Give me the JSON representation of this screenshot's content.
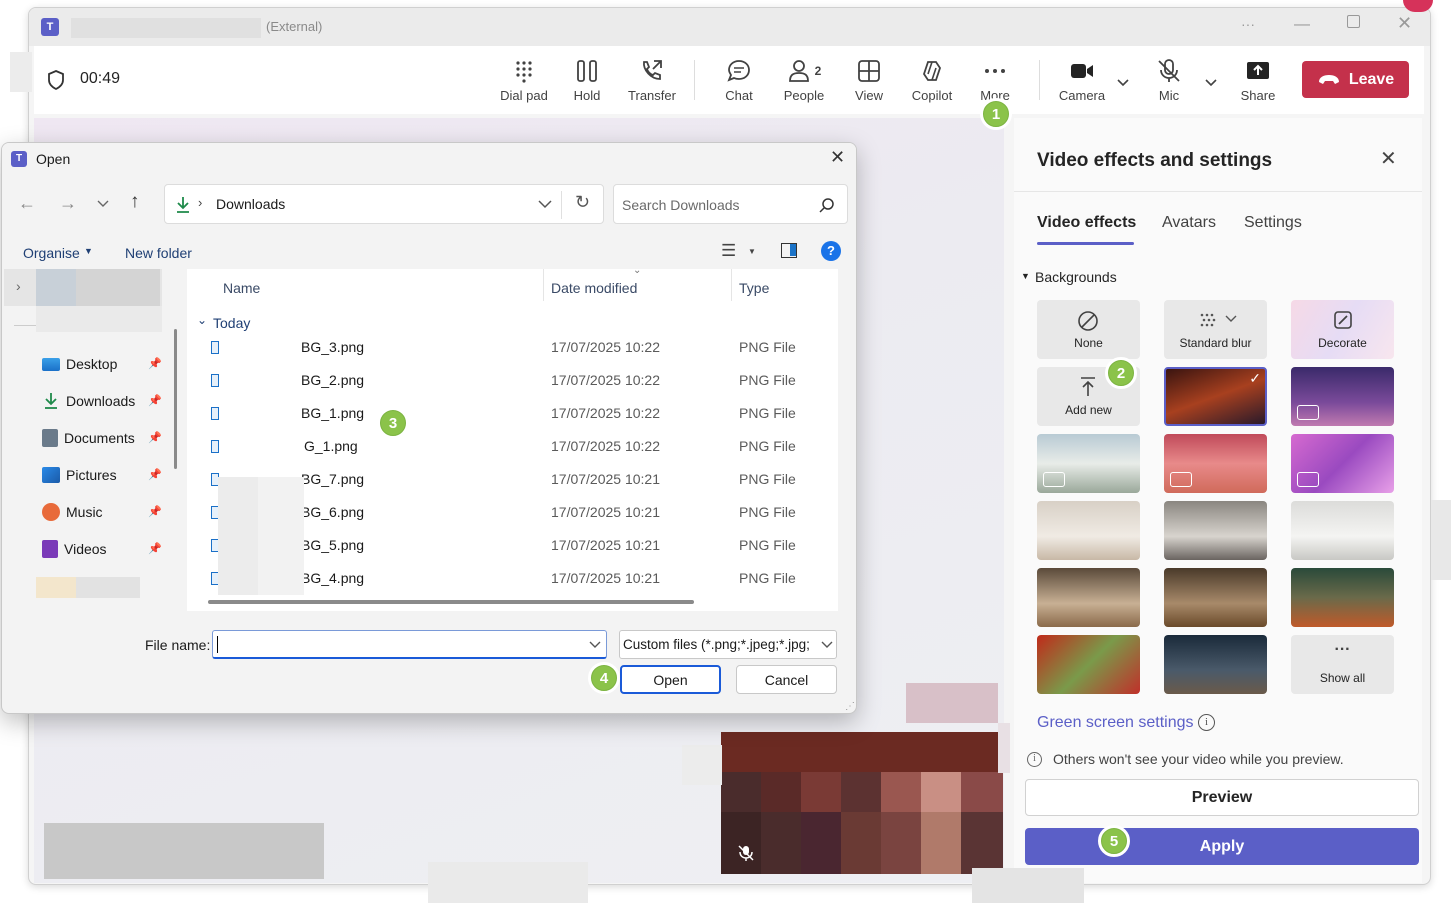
{
  "teams": {
    "title_suffix": "(External)",
    "timer": "00:49",
    "toolbar": {
      "dial_pad": "Dial pad",
      "hold": "Hold",
      "transfer": "Transfer",
      "chat": "Chat",
      "people": "People",
      "people_count": "2",
      "view": "View",
      "copilot": "Copilot",
      "more": "More",
      "camera": "Camera",
      "mic": "Mic",
      "share": "Share",
      "leave": "Leave"
    }
  },
  "panel": {
    "title": "Video effects and settings",
    "tabs": [
      "Video effects",
      "Avatars",
      "Settings"
    ],
    "section": "Backgrounds",
    "tiles": {
      "none": "None",
      "standard_blur": "Standard blur",
      "decorate": "Decorate",
      "add_new": "Add new",
      "show_all": "Show all"
    },
    "green_screen": "Green screen settings",
    "preview_note": "Others won't see your video while you preview.",
    "preview_button": "Preview",
    "apply_button": "Apply"
  },
  "dialog": {
    "title": "Open",
    "path": "Downloads",
    "search_placeholder": "Search Downloads",
    "organise": "Organise",
    "new_folder": "New folder",
    "columns": [
      "Name",
      "Date modified",
      "Type"
    ],
    "group": "Today",
    "files": [
      {
        "name": "BG_3.png",
        "date": "17/07/2025 10:22",
        "type": "PNG File"
      },
      {
        "name": "BG_2.png",
        "date": "17/07/2025 10:22",
        "type": "PNG File"
      },
      {
        "name": "BG_1.png",
        "date": "17/07/2025 10:22",
        "type": "PNG File"
      },
      {
        "name": "G_1.png",
        "date": "17/07/2025 10:22",
        "type": "PNG File"
      },
      {
        "name": "BG_7.png",
        "date": "17/07/2025 10:21",
        "type": "PNG File"
      },
      {
        "name": "BG_6.png",
        "date": "17/07/2025 10:21",
        "type": "PNG File"
      },
      {
        "name": "BG_5.png",
        "date": "17/07/2025 10:21",
        "type": "PNG File"
      },
      {
        "name": "BG_4.png",
        "date": "17/07/2025 10:21",
        "type": "PNG File"
      }
    ],
    "nav": [
      "Desktop",
      "Downloads",
      "Documents",
      "Pictures",
      "Music",
      "Videos"
    ],
    "file_name_label": "File name:",
    "file_name_value": "",
    "filter": "Custom files (*.png;*.jpeg;*.jpg;",
    "open_button": "Open",
    "cancel_button": "Cancel"
  },
  "callouts": [
    "1",
    "2",
    "3",
    "4",
    "5"
  ],
  "colors": {
    "accent": "#5b5fc7",
    "leave": "#c4314b",
    "callout": "#8bc34a"
  }
}
